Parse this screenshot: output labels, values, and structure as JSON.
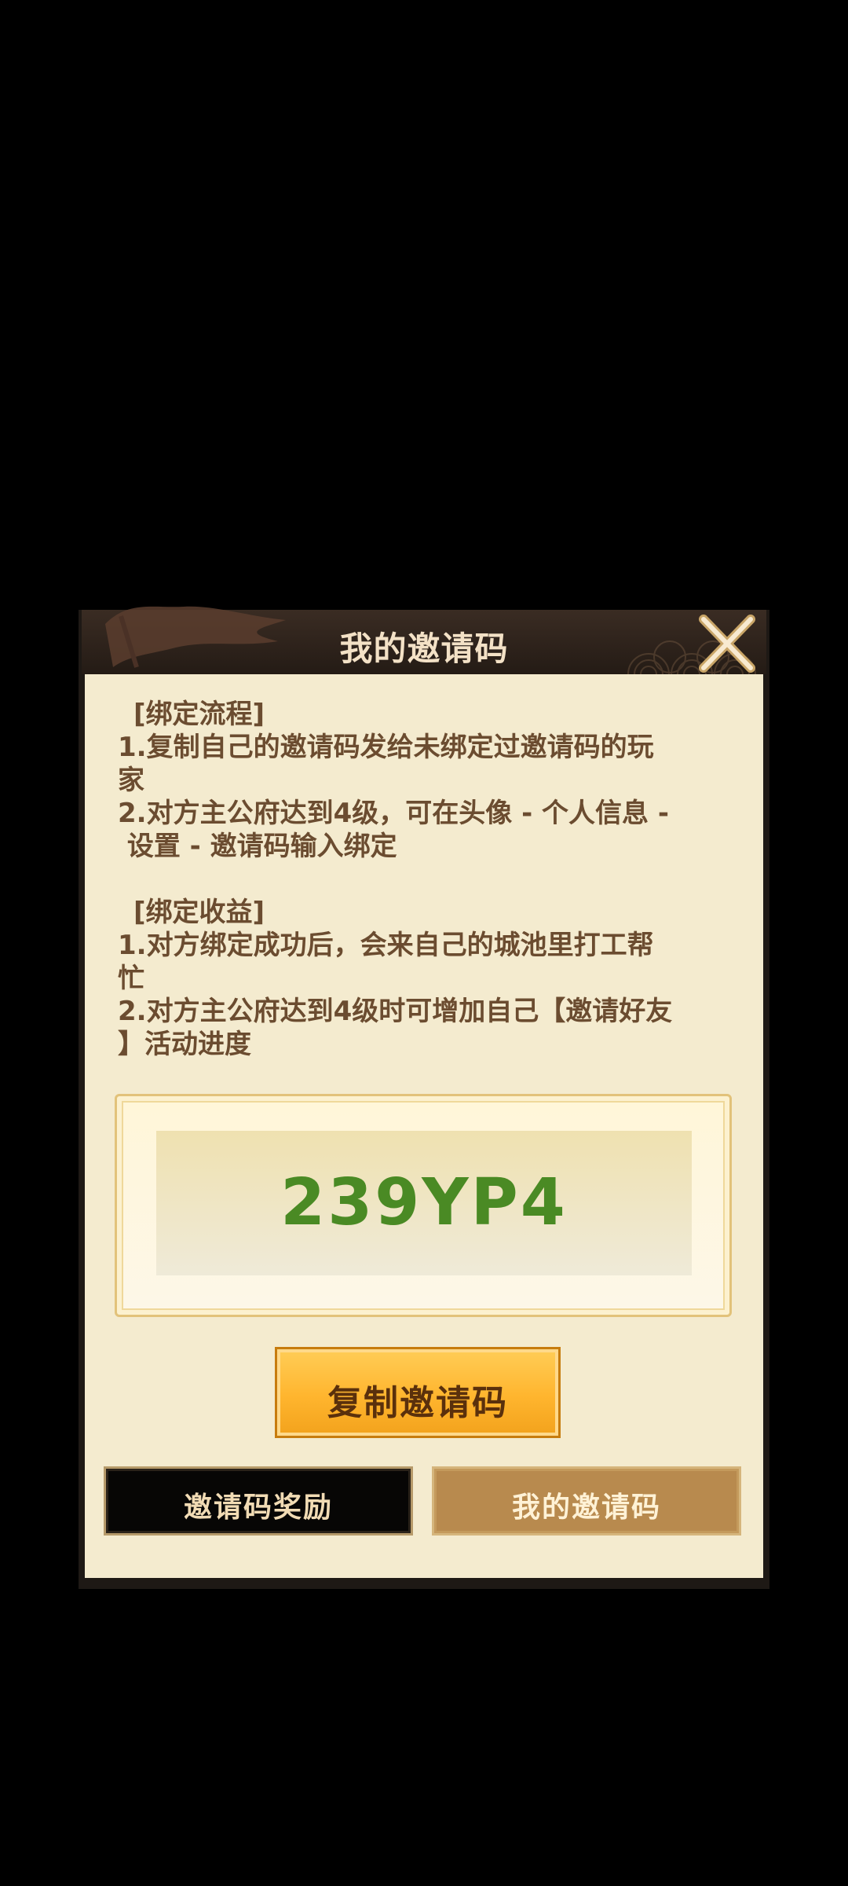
{
  "dialog": {
    "title": "我的邀请码",
    "close_icon": "close-x-icon"
  },
  "rules": {
    "bind_process_heading": "[绑定流程]",
    "bind_process_1_line1": "1.复制自己的邀请码发给未绑定过邀请码的玩",
    "bind_process_1_line2": "家",
    "bind_process_2_line1": "2.对方主公府达到4级，可在头像 - 个人信息 -",
    "bind_process_2_line2": " 设置 - 邀请码输入绑定",
    "bind_benefit_heading": "[绑定收益]",
    "bind_benefit_1_line1": "1.对方绑定成功后，会来自己的城池里打工帮",
    "bind_benefit_1_line2": "忙",
    "bind_benefit_2_line1": "2.对方主公府达到4级时可增加自己【邀请好友",
    "bind_benefit_2_line2": "】活动进度"
  },
  "invite_code": {
    "value": "239YP4",
    "color": "#4a8a24"
  },
  "copy_button": {
    "label": "复制邀请码"
  },
  "tabs": [
    {
      "label": "邀请码奖励",
      "active": false
    },
    {
      "label": "我的邀请码",
      "active": true
    }
  ],
  "colors": {
    "accent": "#ffb52e",
    "panel": "#f4ebcf",
    "text": "#6b4c30"
  }
}
